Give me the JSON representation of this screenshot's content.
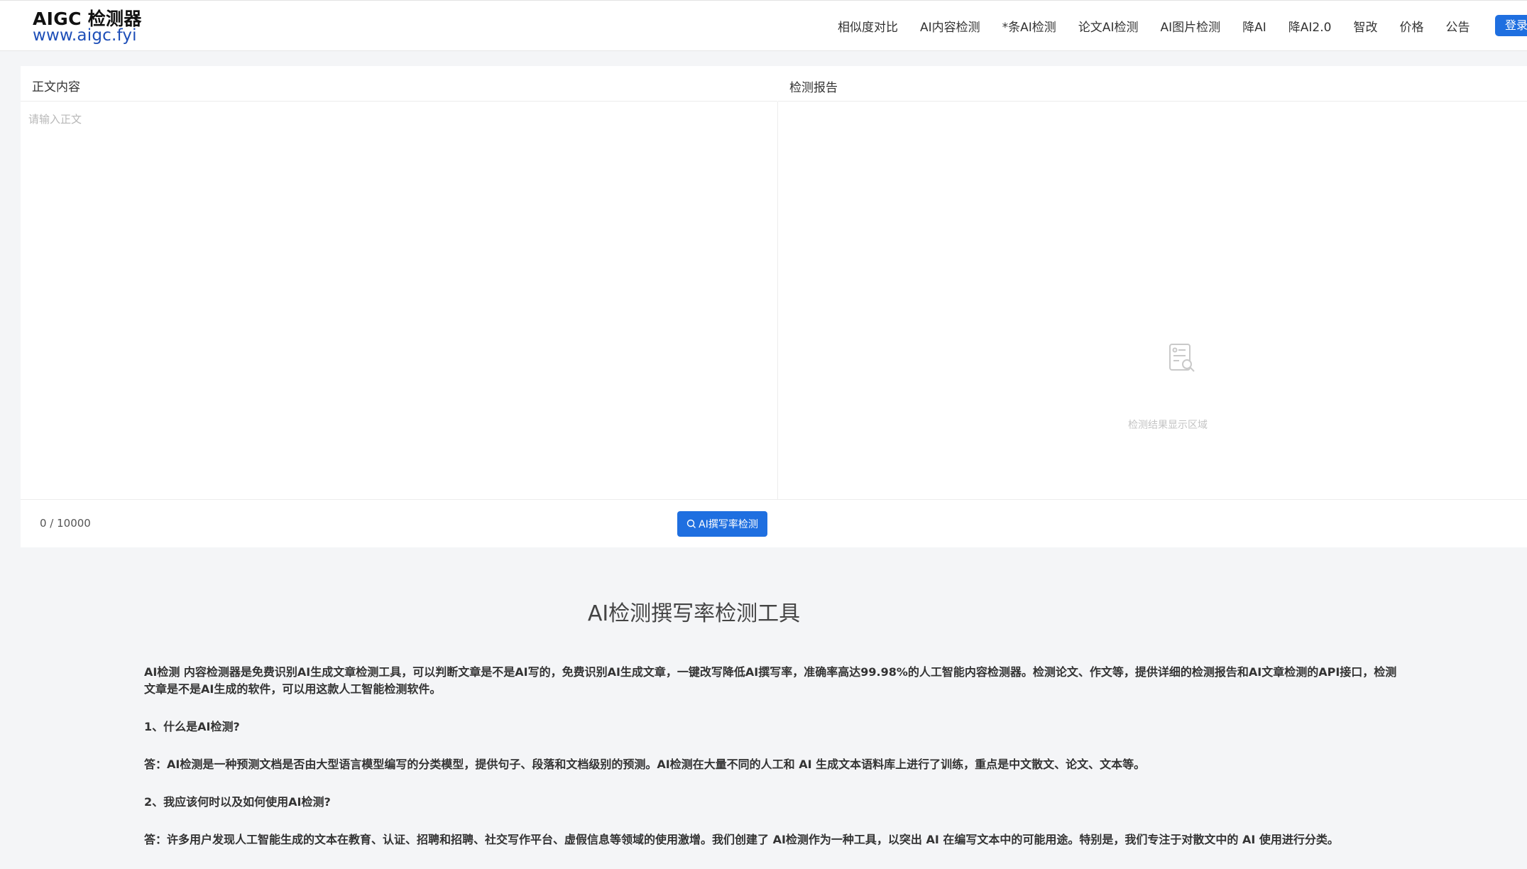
{
  "header": {
    "logo_title": "AIGC 检测器",
    "logo_url": "www.aigc.fyi",
    "nav": [
      "相似度对比",
      "AI内容检测",
      "*条AI检测",
      "论文AI检测",
      "AI图片检测",
      "降AI",
      "降AI2.0",
      "智改",
      "价格",
      "公告"
    ],
    "login_label": "登录"
  },
  "editor": {
    "left_title": "正文内容",
    "placeholder": "请输入正文",
    "right_title": "检测报告",
    "empty_text": "检测结果显示区域",
    "counter": "0 / 10000",
    "detect_label": "AI撰写率检测"
  },
  "intro": {
    "title": "AI检测撰写率检测工具",
    "paragraphs": [
      "AI检测 内容检测器是免费识别AI生成文章检测工具，可以判断文章是不是AI写的，免费识别AI生成文章，一键改写降低AI撰写率，准确率高达99.98%的人工智能内容检测器。检测论文、作文等，提供详细的检测报告和AI文章检测的API接口，检测文章是不是AI生成的软件，可以用这款人工智能检测软件。",
      "1、什么是AI检测?",
      "答：AI检测是一种预测文档是否由大型语言模型编写的分类模型，提供句子、段落和文档级别的预测。AI检测在大量不同的人工和 AI 生成文本语料库上进行了训练，重点是中文散文、论文、文本等。",
      "2、我应该何时以及如何使用AI检测?",
      "答：许多用户发现人工智能生成的文本在教育、认证、招聘和招聘、社交写作平台、虚假信息等领域的使用激增。我们创建了 AI检测作为一种工具，以突出 AI 在编写文本中的可能用途。特别是，我们专注于对散文中的 AI 使用进行分类。"
    ]
  },
  "colors": {
    "accent": "#1f6fe0",
    "logo_url": "#1e4fb8",
    "page_bg": "#f4f5f7"
  }
}
